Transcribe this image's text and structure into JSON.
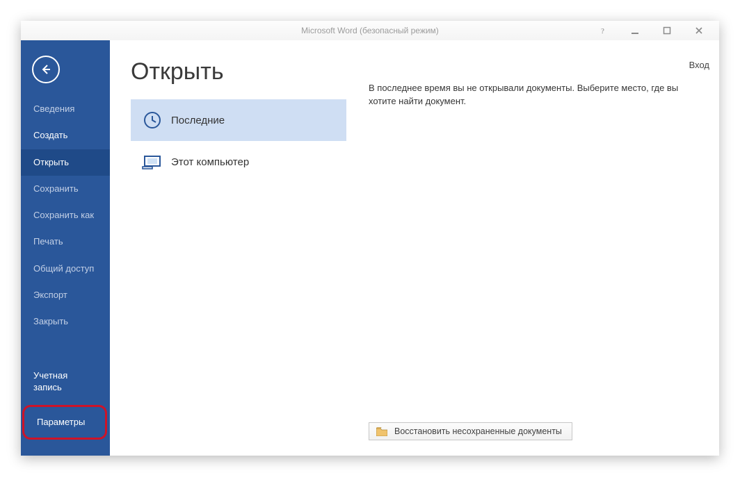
{
  "window": {
    "title": "Microsoft Word (безопасный режим)"
  },
  "signin_label": "Вход",
  "sidebar": {
    "items": [
      {
        "label": "Сведения"
      },
      {
        "label": "Создать"
      },
      {
        "label": "Открыть"
      },
      {
        "label": "Сохранить"
      },
      {
        "label": "Сохранить как"
      },
      {
        "label": "Печать"
      },
      {
        "label": "Общий доступ"
      },
      {
        "label": "Экспорт"
      },
      {
        "label": "Закрыть"
      }
    ],
    "account_label": "Учетная запись",
    "options_label": "Параметры"
  },
  "page": {
    "title": "Открыть",
    "places": [
      {
        "label": "Последние",
        "icon": "clock"
      },
      {
        "label": "Этот компьютер",
        "icon": "computer"
      }
    ],
    "hint": "В последнее время вы не открывали документы. Выберите место, где вы хотите найти документ.",
    "recover_label": "Восстановить несохраненные документы"
  }
}
